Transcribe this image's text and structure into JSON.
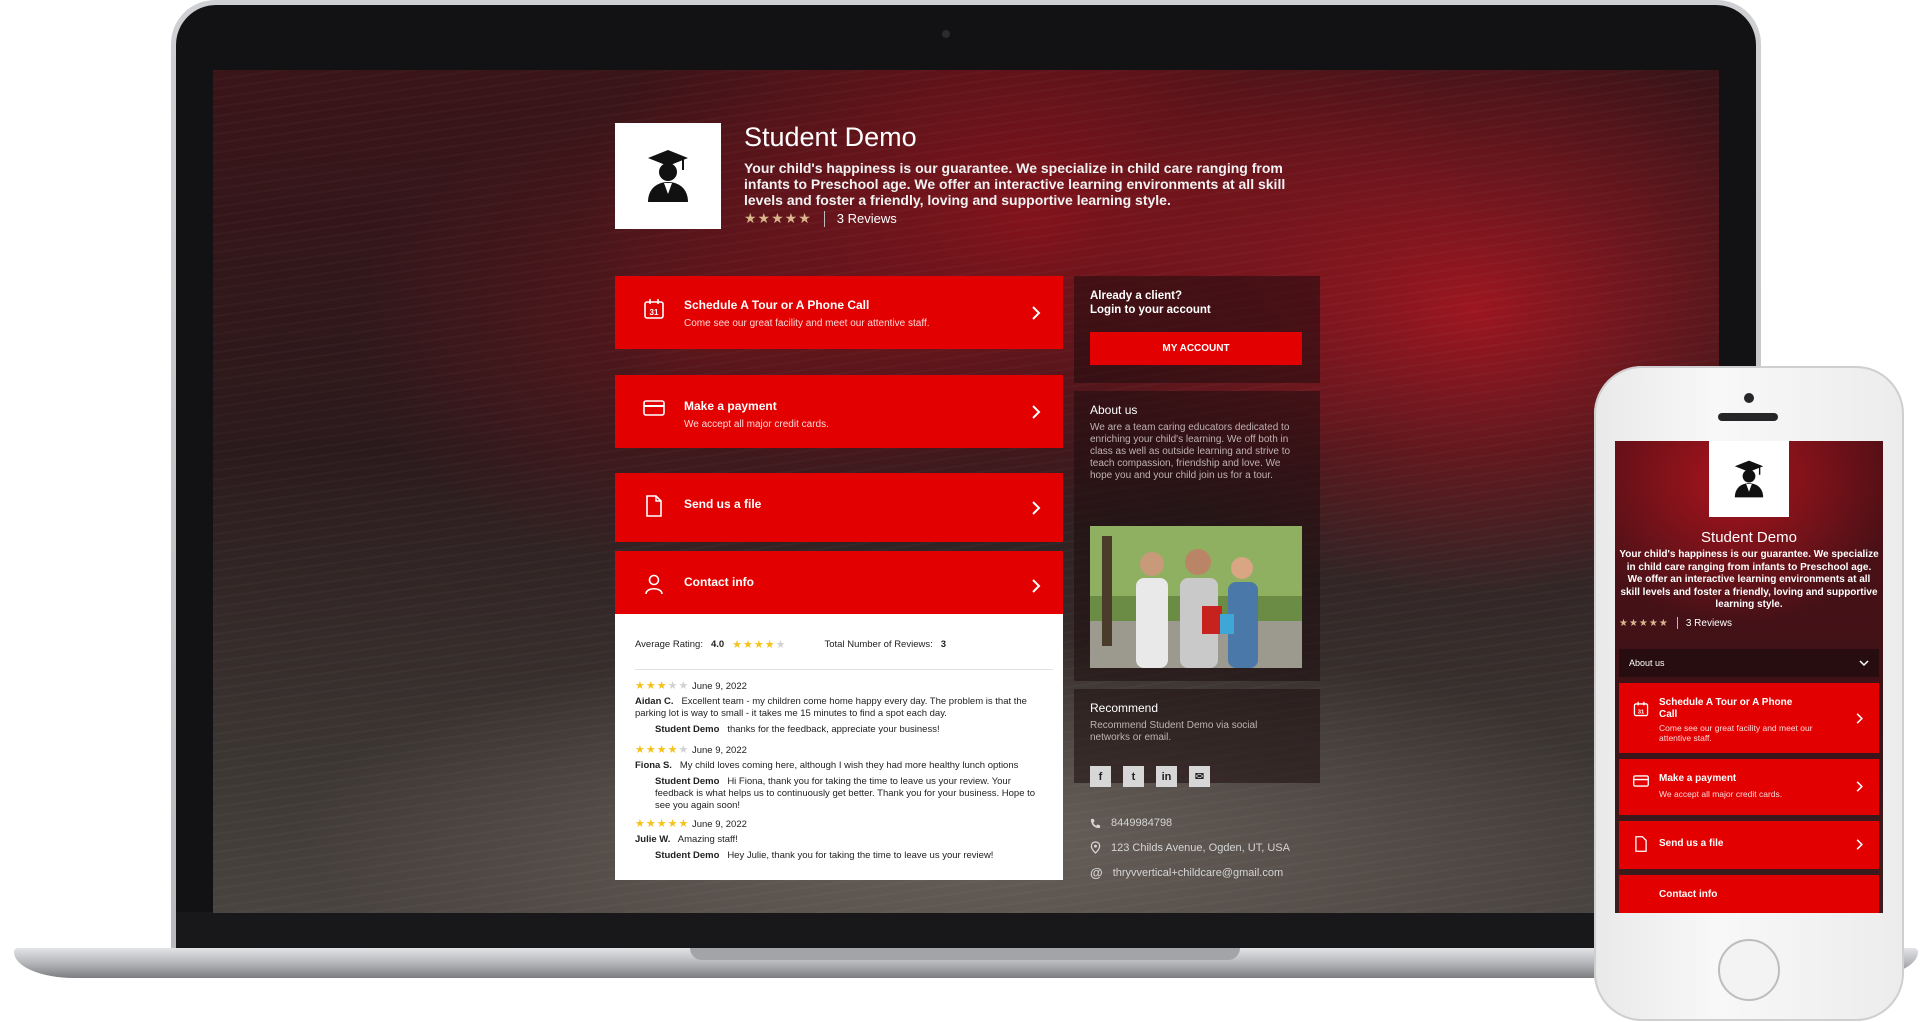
{
  "business": {
    "name": "Student Demo",
    "description": "Your child's happiness is our guarantee. We specialize in child care ranging from infants to Preschool age. We offer an interactive learning environments at all skill levels and foster a friendly, loving and supportive learning style.",
    "stars": "★★★★★",
    "reviews_link": "3 Reviews"
  },
  "actions": [
    {
      "title": "Schedule A Tour or A Phone Call",
      "subtitle": "Come see our great facility and meet our attentive staff.",
      "icon": "calendar-icon",
      "icon_text": "31"
    },
    {
      "title": "Make a payment",
      "subtitle": "We accept all major credit cards.",
      "icon": "credit-card-icon"
    },
    {
      "title": "Send us a file",
      "subtitle": "",
      "icon": "file-icon"
    },
    {
      "title": "Contact info",
      "subtitle": "",
      "icon": "user-icon"
    }
  ],
  "review_summary": {
    "average_label": "Average Rating:",
    "average_value": "4.0",
    "total_label": "Total Number of Reviews:",
    "total_value": "3"
  },
  "reviews": [
    {
      "rating": 3,
      "date": "June 9, 2022",
      "author": "Aidan C.",
      "text": "Excellent team - my children come home happy every day. The problem is that the parking lot is way to small - it takes me 15 minutes to find a spot each day.",
      "reply_author": "Student Demo",
      "reply_text": "thanks for the feedback, appreciate your business!"
    },
    {
      "rating": 4,
      "date": "June 9, 2022",
      "author": "Fiona S.",
      "text": "My child loves coming here, although I wish they had more healthy lunch options",
      "reply_author": "Student Demo",
      "reply_text": "Hi Fiona, thank you for taking the time to leave us your review. Your feedback is what helps us to continuously get better. Thank you for your business. Hope to see you again soon!"
    },
    {
      "rating": 5,
      "date": "June 9, 2022",
      "author": "Julie W.",
      "text": "Amazing staff!",
      "reply_author": "Student Demo",
      "reply_text": "Hey Julie, thank you for taking the time to leave us your review!"
    }
  ],
  "client_panel": {
    "line1": "Already a client?",
    "line2": "Login to your account",
    "button": "MY ACCOUNT"
  },
  "about": {
    "title": "About us",
    "text": "We are a team caring educators dedicated to enriching your child's learning.  We off both in class as well as outside learning and strive to teach compassion, friendship and love.  We hope you and your child join us for a tour."
  },
  "recommend": {
    "title": "Recommend",
    "text": "Recommend Student Demo via social networks or email.",
    "social": [
      "f",
      "t",
      "in",
      "✉"
    ]
  },
  "contact": {
    "phone": "8449984798",
    "address": "123 Childs Avenue, Ogden, UT, USA",
    "email": "thryvvertical+childcare@gmail.com"
  },
  "mobile": {
    "about_label": "About us",
    "schedule_line1": "Schedule A Tour or A Phone",
    "schedule_line2": "Call",
    "contact_partial": "Contact info"
  },
  "colors": {
    "accent": "#e30000",
    "star_gold": "#d8b58a",
    "star_yellow": "#f5c21a"
  }
}
